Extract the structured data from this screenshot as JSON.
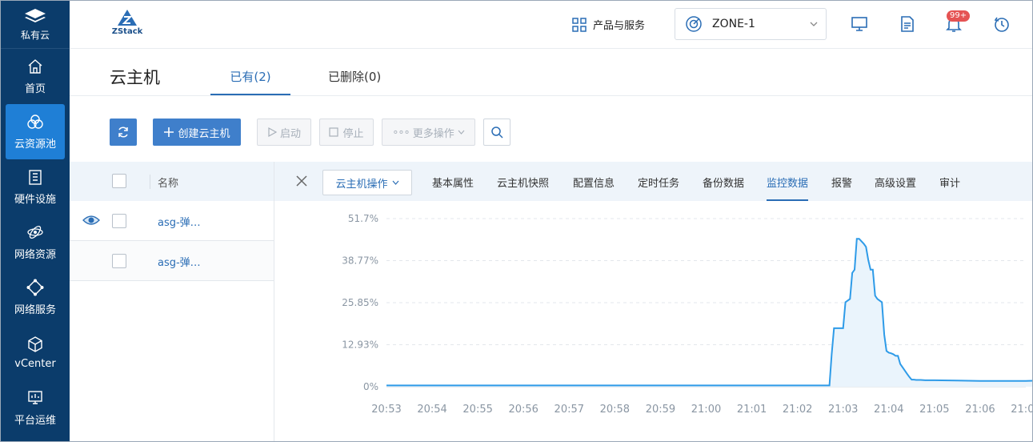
{
  "nav": {
    "logo_label": "私有云",
    "items": [
      {
        "label": "首页",
        "icon": "home-icon"
      },
      {
        "label": "云资源池",
        "icon": "resource-pool-icon"
      },
      {
        "label": "硬件设施",
        "icon": "hardware-icon"
      },
      {
        "label": "网络资源",
        "icon": "network-resource-icon"
      },
      {
        "label": "网络服务",
        "icon": "network-service-icon"
      },
      {
        "label": "vCenter",
        "icon": "vcenter-icon"
      },
      {
        "label": "平台运维",
        "icon": "ops-icon"
      }
    ],
    "active_index": 1
  },
  "header": {
    "brand": "ZStack",
    "products_label": "产品与服务",
    "zone": "ZONE-1",
    "notification_badge": "99+"
  },
  "page": {
    "title": "云主机",
    "tabs": [
      {
        "label": "已有(2)",
        "active": true
      },
      {
        "label": "已删除(0)",
        "active": false
      }
    ]
  },
  "toolbar": {
    "create_label": "创建云主机",
    "start_label": "启动",
    "stop_label": "停止",
    "more_label": "更多操作"
  },
  "list": {
    "name_header": "名称",
    "rows": [
      {
        "name": "asg-弹…",
        "selected": true
      },
      {
        "name": "asg-弹…",
        "selected": false
      }
    ]
  },
  "detail": {
    "vm_ops_label": "云主机操作",
    "tabs": [
      "基本属性",
      "云主机快照",
      "配置信息",
      "定时任务",
      "备份数据",
      "监控数据",
      "报警",
      "高级设置",
      "审计"
    ],
    "active_tab": "监控数据"
  },
  "colors": {
    "nav_bg": "#0b3c6b",
    "nav_active": "#1f7fd6",
    "accent": "#2a6db5",
    "line": "#2e9be8"
  },
  "chart_data": {
    "type": "area",
    "ytick_labels": [
      "0%",
      "12.93%",
      "25.85%",
      "38.77%",
      "51.7%"
    ],
    "ylim": [
      0,
      51.7
    ],
    "xtick_labels": [
      "20:53",
      "20:54",
      "20:55",
      "20:56",
      "20:57",
      "20:58",
      "20:59",
      "21:00",
      "21:01",
      "21:02",
      "21:03",
      "21:04",
      "21:05",
      "21:06",
      "21:07"
    ],
    "x": [
      0,
      1,
      2,
      3,
      4,
      5,
      6,
      7,
      8,
      9,
      9.7,
      9.75,
      9.8,
      10.0,
      10.05,
      10.15,
      10.2,
      10.25,
      10.3,
      10.35,
      10.45,
      10.5,
      10.55,
      10.6,
      10.65,
      10.7,
      10.75,
      10.8,
      10.85,
      10.9,
      10.95,
      11.0,
      11.05,
      11.1,
      11.15,
      11.2,
      11.25,
      11.3,
      11.4,
      11.45,
      11.5,
      11.55,
      11.6,
      11.7,
      11.8,
      12.0,
      12.5,
      13.0,
      13.5,
      14.0,
      14.5,
      14.8
    ],
    "values": [
      0.4,
      0.4,
      0.4,
      0.4,
      0.4,
      0.4,
      0.4,
      0.4,
      0.4,
      0.4,
      0.4,
      10.0,
      18.0,
      18.0,
      26.0,
      27.0,
      35.0,
      36.0,
      45.5,
      45.5,
      44.0,
      43.0,
      39.0,
      36.0,
      36.0,
      28.0,
      27.0,
      26.5,
      26.0,
      16.0,
      11.0,
      10.5,
      10.3,
      10.0,
      9.5,
      9.5,
      7.0,
      6.0,
      4.0,
      3.0,
      2.2,
      2.2,
      2.1,
      2.1,
      2.0,
      2.0,
      1.9,
      1.8,
      1.8,
      1.8,
      2.0,
      2.0
    ]
  }
}
